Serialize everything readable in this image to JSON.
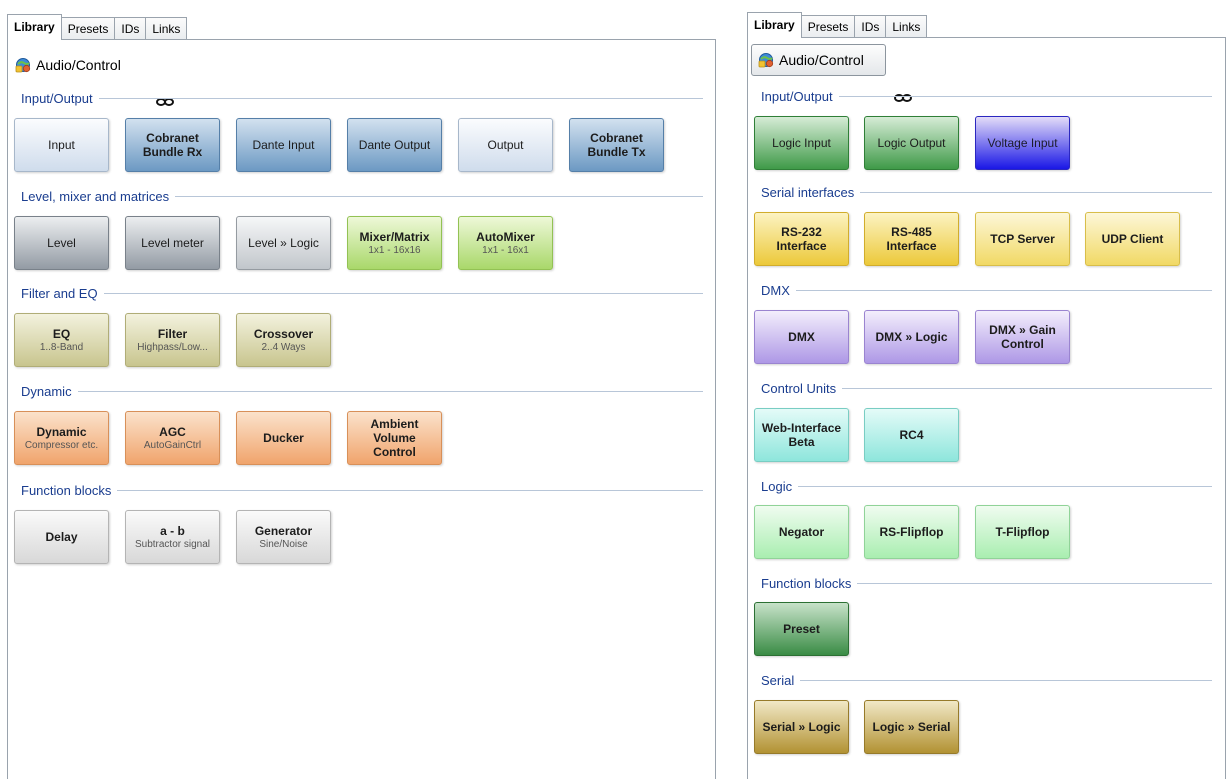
{
  "left": {
    "tabs": [
      {
        "label": "Library",
        "active": true
      },
      {
        "label": "Presets",
        "active": false
      },
      {
        "label": "IDs",
        "active": false
      },
      {
        "label": "Links",
        "active": false
      }
    ],
    "selector": {
      "label": "Audio/Control",
      "icon": "app-icon"
    },
    "sections": {
      "io": {
        "title": "Input/Output"
      },
      "level": {
        "title": "Level, mixer and matrices"
      },
      "filter": {
        "title": "Filter and EQ"
      },
      "dynamic": {
        "title": "Dynamic"
      },
      "function": {
        "title": "Function blocks"
      }
    },
    "blocks": {
      "input": {
        "title": "Input"
      },
      "cobranet_rx": {
        "title": "Cobranet Bundle Rx"
      },
      "dante_input": {
        "title": "Dante Input"
      },
      "dante_output": {
        "title": "Dante Output"
      },
      "output": {
        "title": "Output"
      },
      "cobranet_tx": {
        "title": "Cobranet Bundle Tx"
      },
      "level": {
        "title": "Level"
      },
      "level_meter": {
        "title": "Level meter"
      },
      "level_logic": {
        "title": "Level » Logic"
      },
      "mixer_matrix": {
        "title": "Mixer/Matrix",
        "sub": "1x1 - 16x16"
      },
      "automixer": {
        "title": "AutoMixer",
        "sub": "1x1 - 16x1"
      },
      "eq": {
        "title": "EQ",
        "sub": "1..8-Band"
      },
      "filter": {
        "title": "Filter",
        "sub": "Highpass/Low..."
      },
      "crossover": {
        "title": "Crossover",
        "sub": "2..4 Ways"
      },
      "dynamic": {
        "title": "Dynamic",
        "sub": "Compressor etc."
      },
      "agc": {
        "title": "AGC",
        "sub": "AutoGainCtrl"
      },
      "ducker": {
        "title": "Ducker"
      },
      "ambient": {
        "title": "Ambient Volume Control"
      },
      "delay": {
        "title": "Delay"
      },
      "a_b": {
        "title": "a - b",
        "sub": "Subtractor signal"
      },
      "generator": {
        "title": "Generator",
        "sub": "Sine/Noise"
      }
    }
  },
  "right": {
    "tabs": [
      {
        "label": "Library",
        "active": true
      },
      {
        "label": "Presets",
        "active": false
      },
      {
        "label": "IDs",
        "active": false
      },
      {
        "label": "Links",
        "active": false
      }
    ],
    "selector": {
      "label": "Audio/Control",
      "icon": "app-icon"
    },
    "sections": {
      "io": {
        "title": "Input/Output"
      },
      "serial_if": {
        "title": "Serial interfaces"
      },
      "dmx": {
        "title": "DMX"
      },
      "control_units": {
        "title": "Control Units"
      },
      "logic": {
        "title": "Logic"
      },
      "function": {
        "title": "Function blocks"
      },
      "serial": {
        "title": "Serial"
      }
    },
    "blocks": {
      "logic_input": {
        "title": "Logic Input"
      },
      "logic_output": {
        "title": "Logic Output"
      },
      "voltage_input": {
        "title": "Voltage Input"
      },
      "rs232": {
        "title": "RS-232 Interface"
      },
      "rs485": {
        "title": "RS-485 Interface"
      },
      "tcp_server": {
        "title": "TCP Server"
      },
      "udp_client": {
        "title": "UDP Client"
      },
      "dmx": {
        "title": "DMX"
      },
      "dmx_logic": {
        "title": "DMX » Logic"
      },
      "dmx_gain": {
        "title": "DMX » Gain Control"
      },
      "web_interface": {
        "title": "Web-Interface Beta"
      },
      "rc4": {
        "title": "RC4"
      },
      "negator": {
        "title": "Negator"
      },
      "rs_flipflop": {
        "title": "RS-Flipflop"
      },
      "t_flipflop": {
        "title": "T-Flipflop"
      },
      "preset": {
        "title": "Preset"
      },
      "serial_logic": {
        "title": "Serial » Logic"
      },
      "logic_serial": {
        "title": "Logic » Serial"
      }
    }
  },
  "icons": {
    "selector": "app-icon",
    "link": "link-chain-icon"
  }
}
